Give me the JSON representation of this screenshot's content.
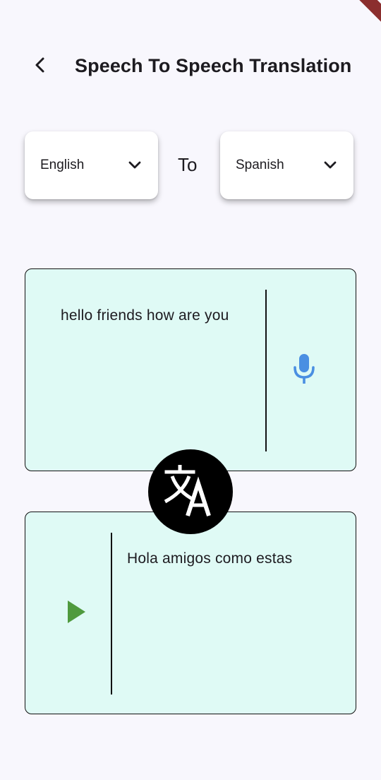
{
  "app": {
    "title": "Speech To Speech Translation"
  },
  "icons": {
    "back": "arrow-back-icon",
    "dropdown": "chevron-down-icon",
    "mic": "mic-icon",
    "play": "play-icon",
    "translate": "translate-icon"
  },
  "colors": {
    "background": "#f8f7fd",
    "card": "#dffaf5",
    "mic": "#4a8fe2",
    "play": "#4f9a3e",
    "translate_button": "#000000"
  },
  "languages": {
    "source": "English",
    "separator": "To",
    "target": "Spanish"
  },
  "input": {
    "text": "hello friends how are you"
  },
  "output": {
    "text": "Hola amigos como estas"
  }
}
